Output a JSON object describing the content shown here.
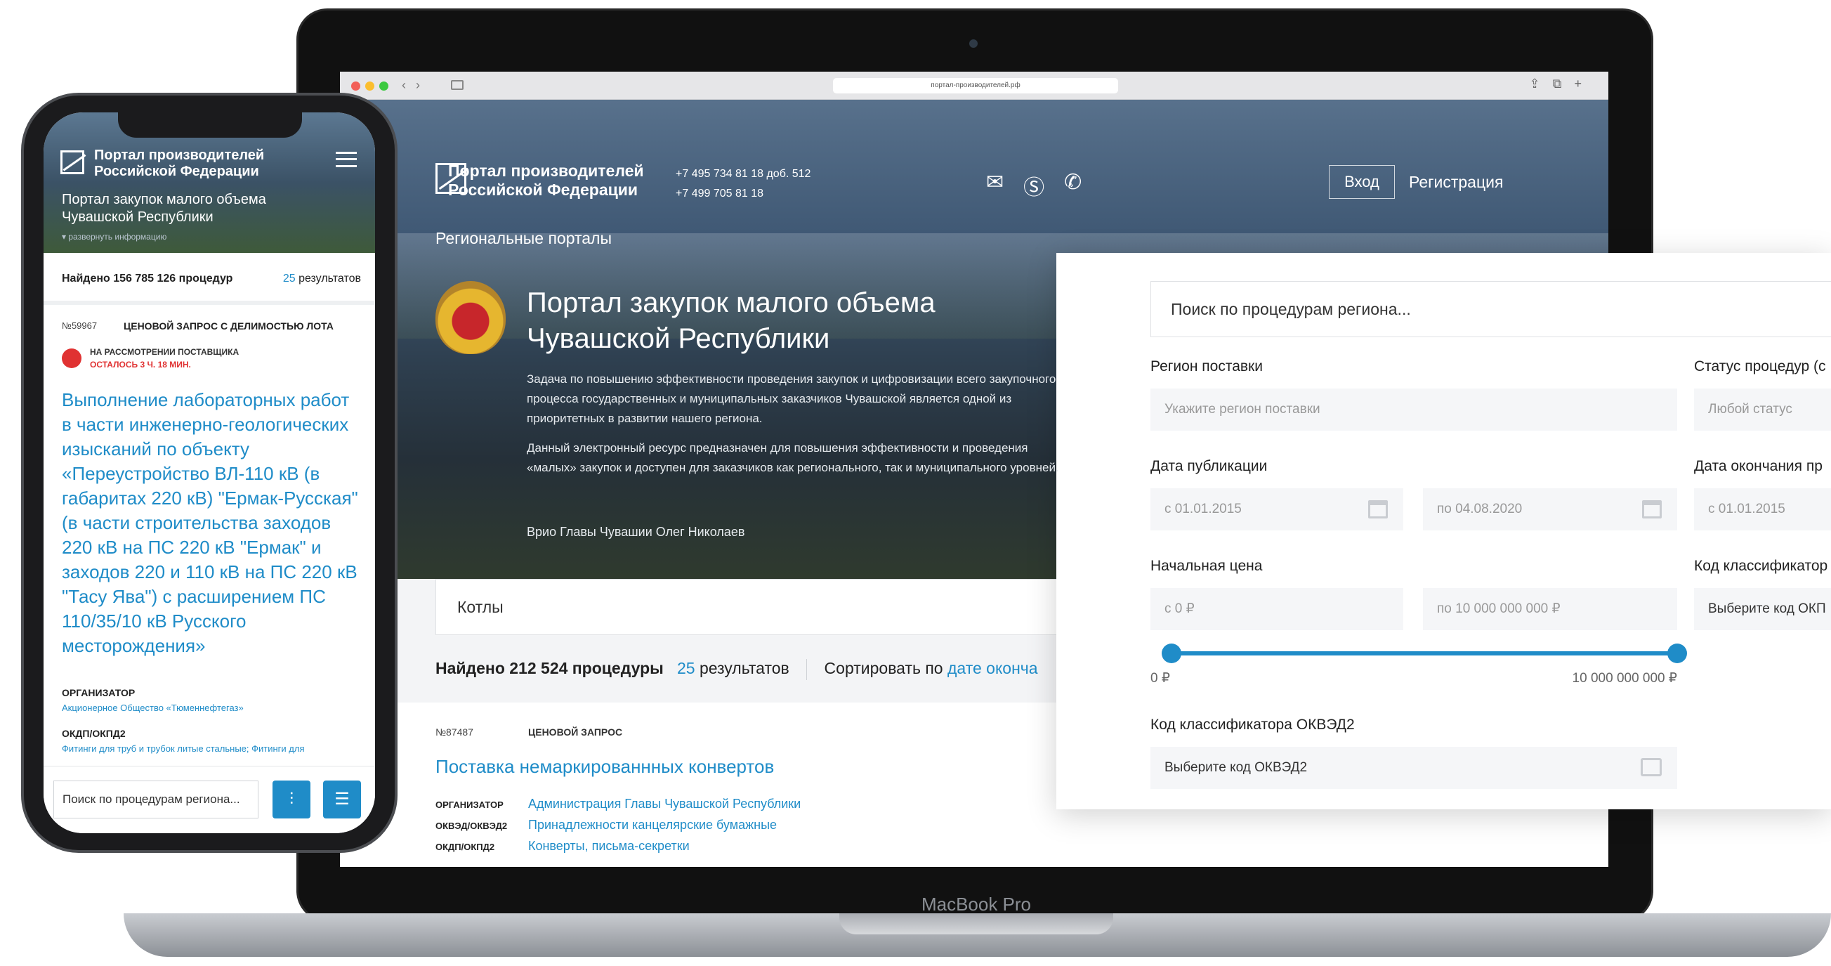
{
  "laptop": {
    "model": "MacBook Pro"
  },
  "browser": {
    "url": "портал-производителей.рф"
  },
  "site": {
    "brand": "Портал производителей Российской Федерации",
    "brand_line1": "Портал производителей",
    "brand_line2": "Российской Федерации",
    "phones": [
      "+7 495 734 81 18 доб. 512",
      "+7 499 705 81 18"
    ],
    "icons": [
      "mail-icon",
      "skype-icon",
      "whatsapp-icon"
    ],
    "login": "Вход",
    "register": "Регистрация",
    "regional": "Региональные порталы"
  },
  "hero": {
    "title_line1": "Портал закупок малого объема",
    "title_line2": "Чувашской Республики",
    "p1": "Задача по повышению эффективности проведения закупок и цифровизации всего закупочного процесса государственных и муниципальных заказчиков Чувашской является одной из приоритетных в развитии нашего региона.",
    "p2": "Данный электронный ресурс предназначен для повышения эффективности и проведения «малых» закупок и доступен для заказчиков как регионального, так и муниципального уровней.",
    "signer": "Врио Главы Чувашии Олег Николаев"
  },
  "main": {
    "search_value": "Котлы",
    "found": "Найдено 212 524 процедуры",
    "results_count": "25",
    "results_label": "результатов",
    "sort_label": "Сортировать по",
    "sort_value": "дате оконча"
  },
  "card": {
    "number": "№87487",
    "type": "ЦЕНОВОЙ ЗАПРОС",
    "title": "Поставка немаркированнных конвертов",
    "rows": [
      {
        "key": "ОРГАНИЗАТОР",
        "value": "Администрация Главы Чувашской Республики"
      },
      {
        "key": "ОКВЭД/ОКВЭД2",
        "value": "Принадлежности канцелярские бумажные"
      },
      {
        "key": "ОКДП/ОКПД2",
        "value": "Конверты, письма-секретки"
      }
    ]
  },
  "filter": {
    "search_placeholder": "Поиск по процедурам региона...",
    "region_label": "Регион поставки",
    "region_placeholder": "Укажите регион поставки",
    "status_label": "Статус процедур (с",
    "status_value": "Любой статус",
    "pub_date_label": "Дата публикации",
    "pub_from": "с 01.01.2015",
    "pub_to": "по 04.08.2020",
    "end_date_label": "Дата окончания пр",
    "end_from": "с 01.01.2015",
    "price_label": "Начальная цена",
    "price_from": "с 0 ₽",
    "price_to": "по 10 000 000 000 ₽",
    "price_min_label": "0 ₽",
    "price_max_label": "10 000 000 000 ₽",
    "classifier_label": "Код классификатор",
    "classifier_value": "Выберите код ОКП",
    "okved_label": "Код классификатора ОКВЭД2",
    "okved_value": "Выберите код ОКВЭД2",
    "accent": "#1f8cc8"
  },
  "phone": {
    "brand_line1": "Портал производителей",
    "brand_line2": "Российской Федерации",
    "portal_line1": "Портал закупок малого объема",
    "portal_line2": "Чувашской Республики",
    "expand": "▾ развернуть информацию",
    "found": "Найдено 156 785 126 процедур",
    "results_count": "25",
    "results_label": "результатов",
    "number": "№59967",
    "type": "ЦЕНОВОЙ ЗАПРОС С ДЕЛИМОСТЬЮ ЛОТА",
    "status": "НА РАССМОТРЕНИИ ПОСТАВЩИКА",
    "time_left": "ОСТАЛОСЬ 3 Ч. 18 МИН.",
    "title": "Выполнение лабораторных работ в части инженерно-геологических изысканий по объекту «Переустройство ВЛ-110 кВ (в габаритах 220 кВ) \"Ермак-Русская\" (в части строительства заходов 220 кВ на ПС 220 кВ \"Ермак\" и заходов 220 и 110 кВ на ПС 220 кВ \"Тасу Ява\") с расширением ПС 110/35/10 кВ Русского месторождения»",
    "org_key": "ОРГАНИЗАТОР",
    "org_value": "Акционерное Общество «Тюменнефтегаз»",
    "okpd_key": "ОКДП/ОКПД2",
    "okpd_value": "Фитинги для труб и трубок литые стальные; Фитинги для",
    "search_placeholder": "Поиск по процедурам региона...",
    "filter_icon": "sliders-icon",
    "list_icon": "list-icon"
  }
}
